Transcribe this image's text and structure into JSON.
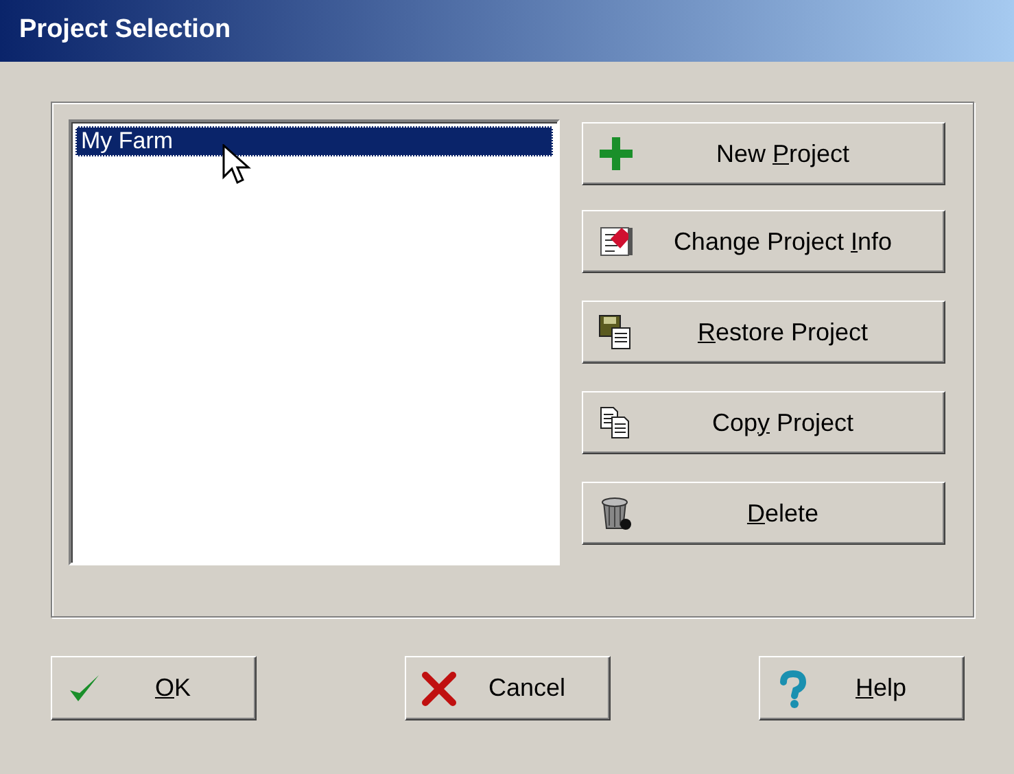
{
  "window": {
    "title": "Project Selection"
  },
  "project_list": {
    "items": [
      {
        "label": "My Farm",
        "selected": true
      }
    ]
  },
  "actions": [
    {
      "kind": "plus",
      "label": [
        {
          "text": "New "
        },
        {
          "text": "P",
          "underlined": true
        },
        {
          "text": "roject"
        }
      ]
    },
    {
      "kind": "edit",
      "label": [
        {
          "text": "Change Project "
        },
        {
          "text": "I",
          "underlined": true
        },
        {
          "text": "nfo"
        }
      ]
    },
    {
      "kind": "restore",
      "label": [
        {
          "text": "R",
          "underlined": true
        },
        {
          "text": "estore Project"
        }
      ]
    },
    {
      "kind": "copy",
      "label": [
        {
          "text": "Cop"
        },
        {
          "text": "y",
          "underlined": true
        },
        {
          "text": " Project"
        }
      ]
    },
    {
      "kind": "delete",
      "label": [
        {
          "text": "D",
          "underlined": true
        },
        {
          "text": "elete"
        }
      ]
    }
  ],
  "buttons": [
    {
      "kind": "check",
      "label": [
        {
          "text": "O",
          "underlined": true
        },
        {
          "text": "K"
        }
      ]
    },
    {
      "kind": "cross",
      "label": [
        {
          "text": "Cancel"
        }
      ]
    },
    {
      "kind": "help",
      "label": [
        {
          "text": "H",
          "underlined": true
        },
        {
          "text": "elp"
        }
      ]
    }
  ]
}
